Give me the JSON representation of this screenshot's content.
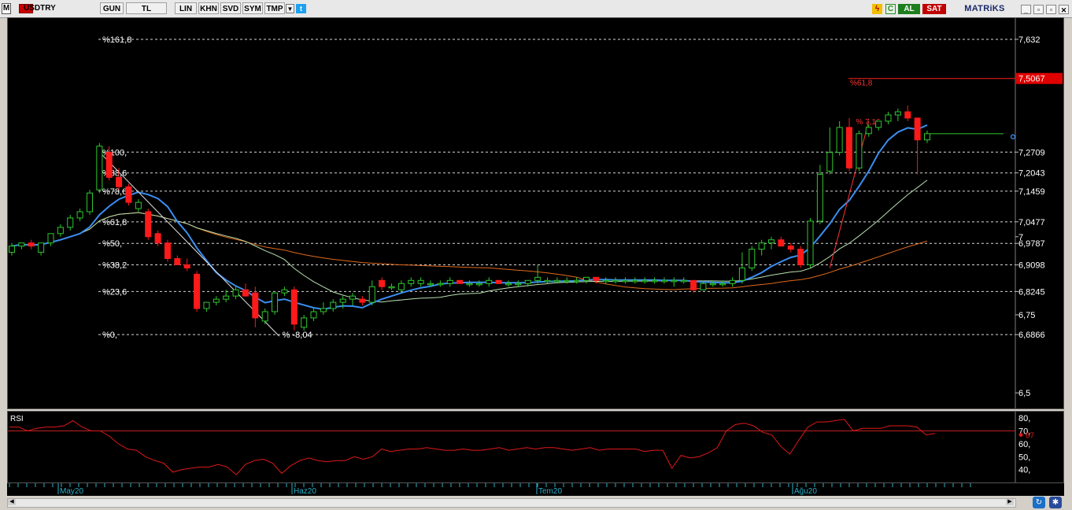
{
  "toolbar": {
    "m_label": "M",
    "symbol": "USDTRY",
    "buttons": [
      "GUN",
      "TL",
      "LIN",
      "KHN",
      "SVD",
      "SYM",
      "TMP"
    ],
    "al_label": "AL",
    "sat_label": "SAT",
    "brand": "MATRiKS"
  },
  "price_axis": {
    "labels": [
      "7,632",
      "7,2709",
      "7,2043",
      "7,1459",
      "7,0477",
      "7",
      "6,9787",
      "6,9098",
      "6,8245",
      "6,75",
      "6,6866",
      "6,5"
    ],
    "highlight_label": "7,5067",
    "highlight_color": "#e00000"
  },
  "fibonacci": {
    "levels": [
      {
        "label": "%161,8",
        "price": 7.632
      },
      {
        "label": "%100,",
        "price": 7.2709
      },
      {
        "label": "%88,6",
        "price": 7.2043
      },
      {
        "label": "%78,6",
        "price": 7.1459
      },
      {
        "label": "%61,8",
        "price": 7.0477
      },
      {
        "label": "%50,",
        "price": 6.9787
      },
      {
        "label": "%38,2",
        "price": 6.9098
      },
      {
        "label": "%23,6",
        "price": 6.8245
      },
      {
        "label": "%0,",
        "price": 6.6866
      }
    ],
    "annotation_low": "% -8,04",
    "annotation_high": "% 7,16",
    "red_level_label": "%61,8",
    "red_level_price": 7.5067
  },
  "rsi": {
    "title": "RSI",
    "axis_labels": [
      "80,",
      "70,",
      "60,",
      "50,",
      "40,"
    ],
    "last_value_label": "67",
    "reference_level": 70,
    "values": [
      73,
      73,
      70,
      72,
      73,
      73,
      74,
      78,
      73,
      70,
      70,
      66,
      60,
      56,
      55,
      50,
      47,
      45,
      38,
      40,
      41,
      42,
      42,
      44,
      42,
      36,
      44,
      47,
      48,
      45,
      37,
      43,
      47,
      49,
      47,
      46,
      47,
      47,
      50,
      48,
      50,
      56,
      54,
      55,
      56,
      56,
      57,
      56,
      55,
      55,
      56,
      55,
      55,
      56,
      57,
      55,
      56,
      57,
      56,
      57,
      57,
      56,
      55,
      56,
      57,
      55,
      56,
      56,
      56,
      56,
      54,
      55,
      55,
      41,
      51,
      49,
      50,
      53,
      57,
      70,
      75,
      76,
      74,
      69,
      67,
      58,
      52,
      63,
      73,
      77,
      77,
      78,
      79,
      70,
      72,
      72,
      72,
      74,
      74,
      74,
      73,
      67,
      68
    ]
  },
  "time_axis": {
    "labels": [
      "May20",
      "Haz20",
      "Tem20",
      "Ağu20"
    ]
  },
  "chart_data": {
    "type": "candlestick",
    "symbol": "USDTRY",
    "ylim": [
      6.45,
      7.7
    ],
    "candles": [
      [
        6.95,
        6.98,
        6.94,
        6.97
      ],
      [
        6.97,
        6.98,
        6.96,
        6.98
      ],
      [
        6.98,
        6.99,
        6.96,
        6.97
      ],
      [
        6.95,
        6.98,
        6.94,
        6.98
      ],
      [
        6.98,
        7.01,
        6.97,
        7.01
      ],
      [
        7.01,
        7.04,
        7.0,
        7.03
      ],
      [
        7.03,
        7.07,
        7.02,
        7.06
      ],
      [
        7.06,
        7.09,
        7.05,
        7.08
      ],
      [
        7.08,
        7.15,
        7.07,
        7.14
      ],
      [
        7.15,
        7.3,
        7.14,
        7.29
      ],
      [
        7.27,
        7.29,
        7.18,
        7.19
      ],
      [
        7.19,
        7.22,
        7.15,
        7.16
      ],
      [
        7.16,
        7.17,
        7.1,
        7.11
      ],
      [
        7.09,
        7.12,
        7.08,
        7.11
      ],
      [
        7.08,
        7.09,
        6.99,
        7.0
      ],
      [
        7.01,
        7.02,
        6.97,
        6.98
      ],
      [
        6.98,
        6.99,
        6.92,
        6.93
      ],
      [
        6.93,
        6.94,
        6.91,
        6.91
      ],
      [
        6.91,
        6.93,
        6.89,
        6.9
      ],
      [
        6.88,
        6.89,
        6.76,
        6.77
      ],
      [
        6.77,
        6.79,
        6.76,
        6.79
      ],
      [
        6.79,
        6.81,
        6.78,
        6.8
      ],
      [
        6.8,
        6.83,
        6.79,
        6.81
      ],
      [
        6.81,
        6.84,
        6.8,
        6.83
      ],
      [
        6.83,
        6.85,
        6.81,
        6.81
      ],
      [
        6.82,
        6.84,
        6.71,
        6.74
      ],
      [
        6.73,
        6.77,
        6.72,
        6.76
      ],
      [
        6.76,
        6.82,
        6.75,
        6.82
      ],
      [
        6.82,
        6.84,
        6.81,
        6.83
      ],
      [
        6.83,
        6.84,
        6.7,
        6.72
      ],
      [
        6.71,
        6.75,
        6.7,
        6.74
      ],
      [
        6.74,
        6.77,
        6.73,
        6.76
      ],
      [
        6.76,
        6.79,
        6.75,
        6.77
      ],
      [
        6.77,
        6.8,
        6.76,
        6.79
      ],
      [
        6.79,
        6.81,
        6.77,
        6.8
      ],
      [
        6.8,
        6.82,
        6.78,
        6.81
      ],
      [
        6.8,
        6.81,
        6.78,
        6.79
      ],
      [
        6.79,
        6.86,
        6.78,
        6.84
      ],
      [
        6.86,
        6.87,
        6.83,
        6.84
      ],
      [
        6.84,
        6.85,
        6.83,
        6.84
      ],
      [
        6.83,
        6.86,
        6.82,
        6.85
      ],
      [
        6.85,
        6.87,
        6.84,
        6.86
      ],
      [
        6.85,
        6.87,
        6.84,
        6.86
      ],
      [
        6.85,
        6.86,
        6.84,
        6.85
      ],
      [
        6.85,
        6.86,
        6.84,
        6.85
      ],
      [
        6.85,
        6.87,
        6.84,
        6.86
      ],
      [
        6.86,
        6.86,
        6.85,
        6.85
      ],
      [
        6.85,
        6.86,
        6.84,
        6.85
      ],
      [
        6.85,
        6.86,
        6.84,
        6.85
      ],
      [
        6.85,
        6.87,
        6.84,
        6.86
      ],
      [
        6.86,
        6.86,
        6.85,
        6.85
      ],
      [
        6.85,
        6.86,
        6.84,
        6.85
      ],
      [
        6.85,
        6.86,
        6.84,
        6.85
      ],
      [
        6.85,
        6.86,
        6.84,
        6.86
      ],
      [
        6.86,
        6.91,
        6.85,
        6.87
      ],
      [
        6.86,
        6.87,
        6.85,
        6.86
      ],
      [
        6.86,
        6.87,
        6.85,
        6.86
      ],
      [
        6.86,
        6.87,
        6.85,
        6.86
      ],
      [
        6.86,
        6.87,
        6.85,
        6.86
      ],
      [
        6.86,
        6.87,
        6.85,
        6.87
      ],
      [
        6.87,
        6.87,
        6.85,
        6.86
      ],
      [
        6.86,
        6.87,
        6.85,
        6.86
      ],
      [
        6.86,
        6.87,
        6.85,
        6.86
      ],
      [
        6.86,
        6.87,
        6.85,
        6.86
      ],
      [
        6.86,
        6.87,
        6.85,
        6.86
      ],
      [
        6.86,
        6.87,
        6.85,
        6.86
      ],
      [
        6.86,
        6.87,
        6.85,
        6.86
      ],
      [
        6.86,
        6.87,
        6.85,
        6.86
      ],
      [
        6.86,
        6.87,
        6.84,
        6.86
      ],
      [
        6.86,
        6.87,
        6.85,
        6.86
      ],
      [
        6.86,
        6.86,
        6.82,
        6.83
      ],
      [
        6.83,
        6.86,
        6.83,
        6.85
      ],
      [
        6.85,
        6.86,
        6.84,
        6.85
      ],
      [
        6.85,
        6.86,
        6.84,
        6.85
      ],
      [
        6.85,
        6.87,
        6.84,
        6.86
      ],
      [
        6.86,
        6.95,
        6.85,
        6.9
      ],
      [
        6.9,
        6.97,
        6.89,
        6.96
      ],
      [
        6.96,
        6.99,
        6.94,
        6.98
      ],
      [
        6.98,
        7.0,
        6.96,
        6.99
      ],
      [
        6.99,
        7.0,
        6.97,
        6.97
      ],
      [
        6.97,
        6.98,
        6.95,
        6.96
      ],
      [
        6.96,
        6.97,
        6.9,
        6.91
      ],
      [
        6.91,
        7.06,
        6.9,
        7.05
      ],
      [
        7.05,
        7.23,
        7.04,
        7.2
      ],
      [
        7.21,
        7.35,
        7.2,
        7.27
      ],
      [
        7.27,
        7.37,
        7.26,
        7.35
      ],
      [
        7.35,
        7.38,
        7.21,
        7.22
      ],
      [
        7.22,
        7.34,
        7.21,
        7.33
      ],
      [
        7.33,
        7.36,
        7.32,
        7.35
      ],
      [
        7.35,
        7.37,
        7.34,
        7.37
      ],
      [
        7.37,
        7.4,
        7.36,
        7.39
      ],
      [
        7.39,
        7.41,
        7.37,
        7.4
      ],
      [
        7.4,
        7.42,
        7.37,
        7.38
      ],
      [
        7.38,
        7.38,
        7.2,
        7.31
      ],
      [
        7.31,
        7.34,
        7.3,
        7.33
      ]
    ]
  }
}
